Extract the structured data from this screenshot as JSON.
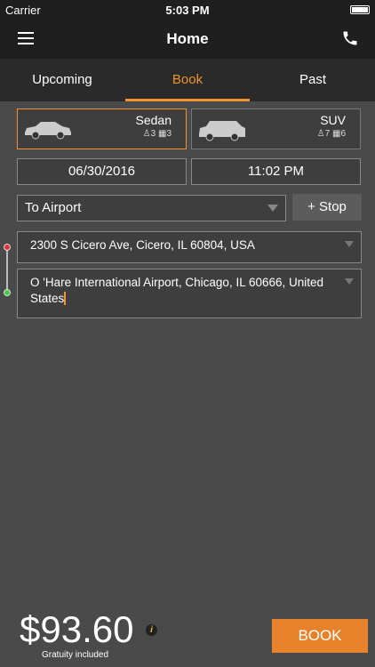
{
  "status": {
    "carrier": "Carrier",
    "time": "5:03 PM"
  },
  "nav": {
    "title": "Home"
  },
  "tabs": [
    {
      "label": "Upcoming"
    },
    {
      "label": "Book",
      "active": true
    },
    {
      "label": "Past"
    }
  ],
  "vehicles": [
    {
      "name": "Sedan",
      "passengers": "3",
      "luggage": "3",
      "selected": true
    },
    {
      "name": "SUV",
      "passengers": "7",
      "luggage": "6",
      "selected": false
    }
  ],
  "booking": {
    "date": "06/30/2016",
    "time": "11:02 PM",
    "trip_type": "To Airport",
    "stop_label": "+ Stop",
    "pickup": "2300 S Cicero Ave, Cicero, IL 60804, USA",
    "dropoff": "O 'Hare International Airport, Chicago, IL 60666, United States"
  },
  "footer": {
    "price": "$93.60",
    "gratuity": "Gratuity included",
    "info_glyph": "i",
    "book_label": "BOOK"
  },
  "colors": {
    "accent": "#f0922d",
    "background": "#4a4a4a",
    "header": "#1f1f1f"
  }
}
